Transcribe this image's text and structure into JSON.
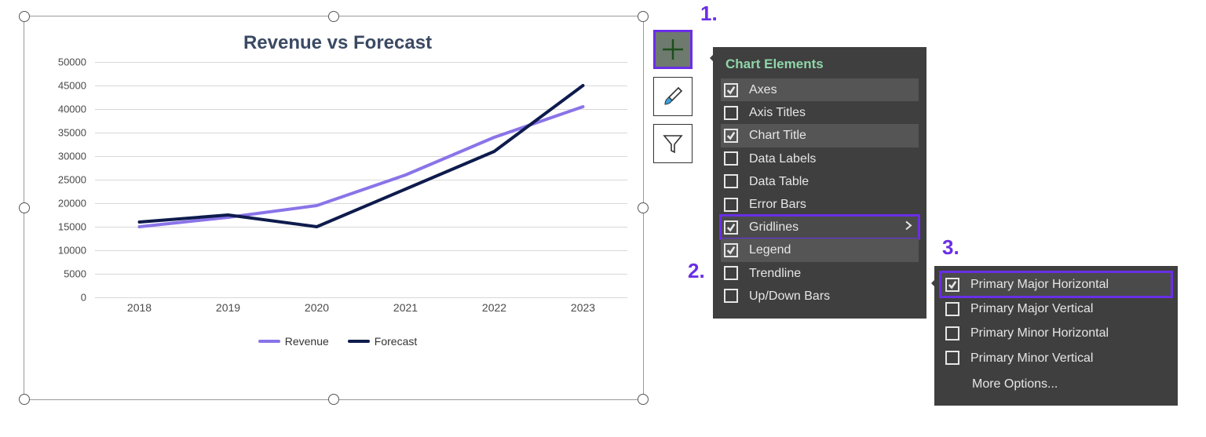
{
  "callouts": {
    "n1": "1.",
    "n2": "2.",
    "n3": "3."
  },
  "chart_data": {
    "type": "line",
    "title": "Revenue vs Forecast",
    "xlabel": "",
    "ylabel": "",
    "categories": [
      "2018",
      "2019",
      "2020",
      "2021",
      "2022",
      "2023"
    ],
    "series": [
      {
        "name": "Revenue",
        "color": "#8a74e8",
        "values": [
          15000,
          17000,
          19500,
          26000,
          34000,
          40500
        ]
      },
      {
        "name": "Forecast",
        "color": "#0e1b4d",
        "values": [
          16000,
          17500,
          15000,
          23000,
          31000,
          45000
        ]
      }
    ],
    "ylim": [
      0,
      50000
    ],
    "y_ticks": [
      0,
      5000,
      10000,
      15000,
      20000,
      25000,
      30000,
      35000,
      40000,
      45000,
      50000
    ],
    "grid": "horizontal"
  },
  "side_buttons": {
    "plus_title": "Chart Elements",
    "brush_title": "Chart Styles",
    "funnel_title": "Chart Filters"
  },
  "popup": {
    "title": "Chart Elements",
    "items": [
      {
        "label": "Axes",
        "checked": true
      },
      {
        "label": "Axis Titles",
        "checked": false
      },
      {
        "label": "Chart Title",
        "checked": true
      },
      {
        "label": "Data Labels",
        "checked": false
      },
      {
        "label": "Data Table",
        "checked": false
      },
      {
        "label": "Error Bars",
        "checked": false
      },
      {
        "label": "Gridlines",
        "checked": true,
        "has_submenu": true,
        "selected": true
      },
      {
        "label": "Legend",
        "checked": true
      },
      {
        "label": "Trendline",
        "checked": false
      },
      {
        "label": "Up/Down Bars",
        "checked": false
      }
    ]
  },
  "subpopup": {
    "items": [
      {
        "label": "Primary Major Horizontal",
        "checked": true,
        "selected": true
      },
      {
        "label": "Primary Major Vertical",
        "checked": false
      },
      {
        "label": "Primary Minor Horizontal",
        "checked": false
      },
      {
        "label": "Primary Minor Vertical",
        "checked": false
      }
    ],
    "more": "More Options..."
  }
}
